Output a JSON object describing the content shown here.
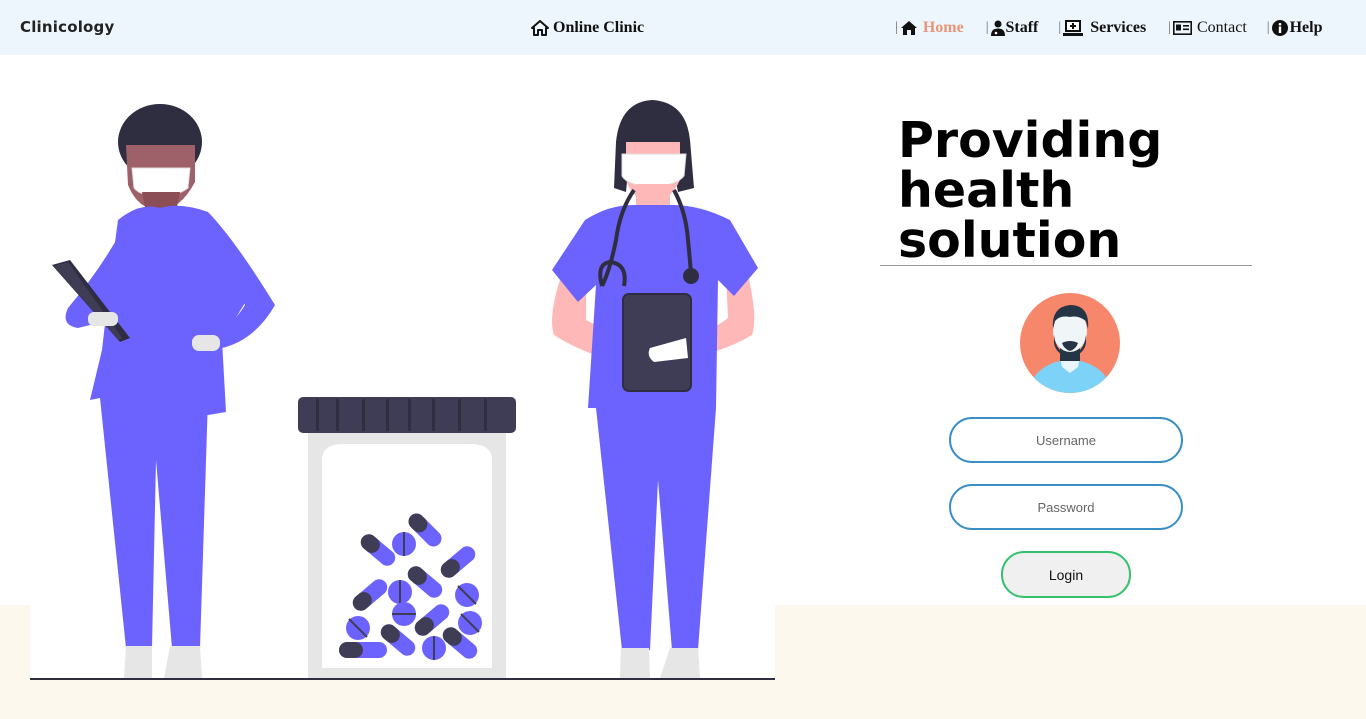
{
  "brand": "Clinicology",
  "header": {
    "title": "Online Clinic",
    "title_icon": "home-icon"
  },
  "nav": {
    "separator": "|",
    "items": [
      {
        "label": "Home",
        "icon": "home-icon",
        "active": true
      },
      {
        "label": "Staff",
        "icon": "user-doctor-icon"
      },
      {
        "label": "Services",
        "icon": "laptop-medical-icon"
      },
      {
        "label": "Contact",
        "icon": "id-card-icon"
      },
      {
        "label": "Help",
        "icon": "info-circle-icon"
      }
    ]
  },
  "hero": {
    "line1": "Providing",
    "line2": "health solution"
  },
  "login": {
    "username_placeholder": "Username",
    "password_placeholder": "Password",
    "button_label": "Login"
  },
  "colors": {
    "header_bg": "#eef6fd",
    "active_nav": "#e8967a",
    "scrubs": "#6c63ff",
    "input_border": "#3a8fc7",
    "button_border": "#35c16d",
    "avatar_bg": "#f7876b",
    "footer_bg": "#fdf8ed"
  }
}
